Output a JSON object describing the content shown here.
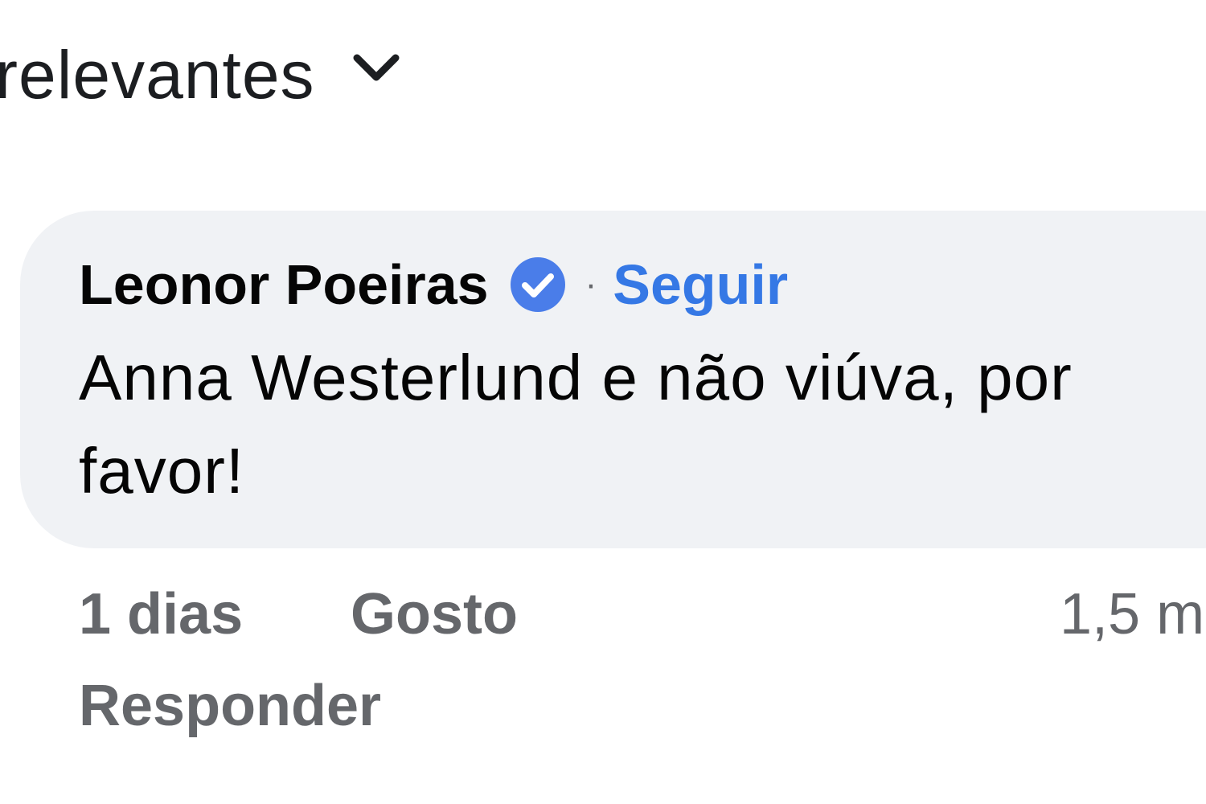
{
  "sort": {
    "label": "relevantes",
    "icon": "chevron-down-icon"
  },
  "comment": {
    "author": "Leonor Poeiras",
    "verified_icon": "verified-badge-icon",
    "separator": "·",
    "follow_label": "Seguir",
    "text": "Anna Westerlund e não viúva, por favor!",
    "time": "1 dias",
    "like_label": "Gosto",
    "count_partial": "1,5 m",
    "reply_label": "Responder"
  },
  "colors": {
    "bubble_bg": "#f0f2f5",
    "text_primary": "#050505",
    "text_secondary": "#65676b",
    "accent_blue": "#3578e5",
    "verified_blue": "#4a7de9"
  }
}
